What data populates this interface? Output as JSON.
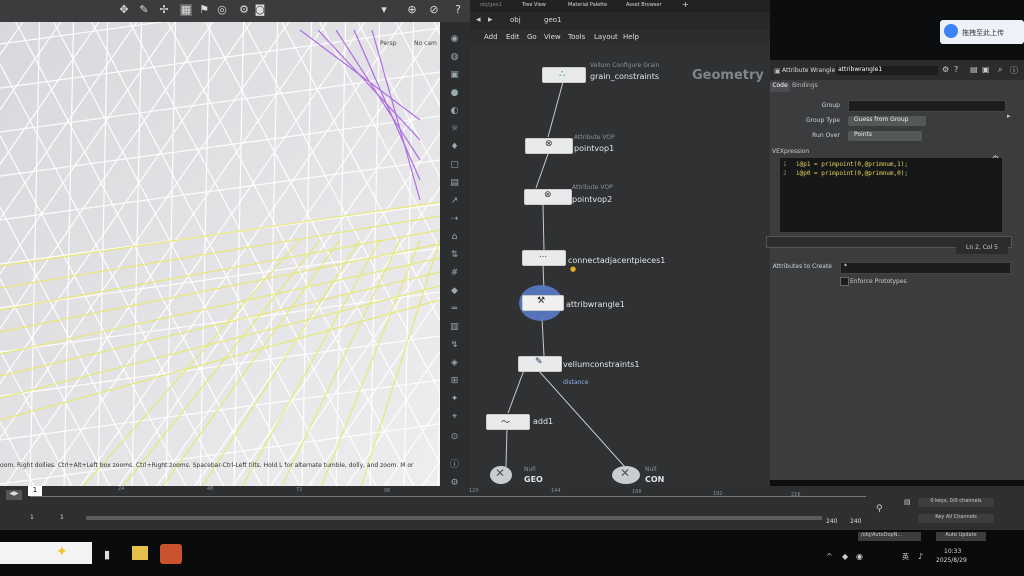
{
  "viewport": {
    "camera_label": "Persp",
    "cam_label": "No cam",
    "help_text": "oom. Right dollies. Ctrl+Alt+Left box zooms. Ctrl+Right zooms. Spacebar-Ctrl-Left tilts. Hold L for alternate tumble, dolly, and zoom.   M or",
    "grid_color": "#ffffff",
    "highlight_yellow": "#e8e86a",
    "highlight_purple": "#a050e0"
  },
  "network": {
    "tabs": [
      "Tree View",
      "Material Palette",
      "Asset Browser"
    ],
    "path_obj": "obj",
    "path_geo": "geo1",
    "menu": [
      "Add",
      "Edit",
      "Go",
      "View",
      "Tools",
      "Layout",
      "Help"
    ],
    "context_label": "Geometry",
    "nodes": [
      {
        "name": "grain_constraints",
        "type": "Vellum Configure Grain"
      },
      {
        "name": "pointvop1",
        "type": "Attribute VOP"
      },
      {
        "name": "pointvop2",
        "type": "Attribute VOP"
      },
      {
        "name": "connectadjacentpieces1",
        "type": ""
      },
      {
        "name": "attribwrangle1",
        "type": ""
      },
      {
        "name": "vellumconstraints1",
        "type": "distance"
      },
      {
        "name": "add1",
        "type": ""
      },
      {
        "name": "GEO",
        "type": "Null"
      },
      {
        "name": "CON",
        "type": "Null"
      }
    ]
  },
  "params": {
    "node_type": "Attribute Wrangle",
    "node_name": "attribwrangle1",
    "tabs": [
      "Code",
      "Bindings"
    ],
    "group_label": "Group",
    "group_type_label": "Group Type",
    "group_type_value": "Guess from Group",
    "run_over_label": "Run Over",
    "run_over_value": "Points",
    "vex_label": "VEXpression",
    "code_lines": [
      "i@p1 = primpoint(0,@primnum,1);",
      "i@p0 = primpoint(0,@primnum,0);"
    ],
    "cursor_pos": "Ln 2, Col 5",
    "attrs_label": "Attributes to Create",
    "attrs_value": "*",
    "enforce_label": "Enforce Prototypes"
  },
  "timeline": {
    "current_frame": "1",
    "ticks": [
      "24",
      "48",
      "72",
      "96",
      "120",
      "144",
      "168",
      "192",
      "216"
    ],
    "start": "1",
    "start2": "1",
    "end": "240",
    "end2": "240",
    "keys_label": "0 keys, 0/0 channels",
    "key_all": "Key All Channels",
    "auto_update": "Auto Update",
    "obj_path": "/obj/AutoDopN..."
  },
  "taskbar": {
    "time": "10:33",
    "date": "2025/8/29",
    "input_lang": "英",
    "upload_label": "拖拽至此上传"
  }
}
